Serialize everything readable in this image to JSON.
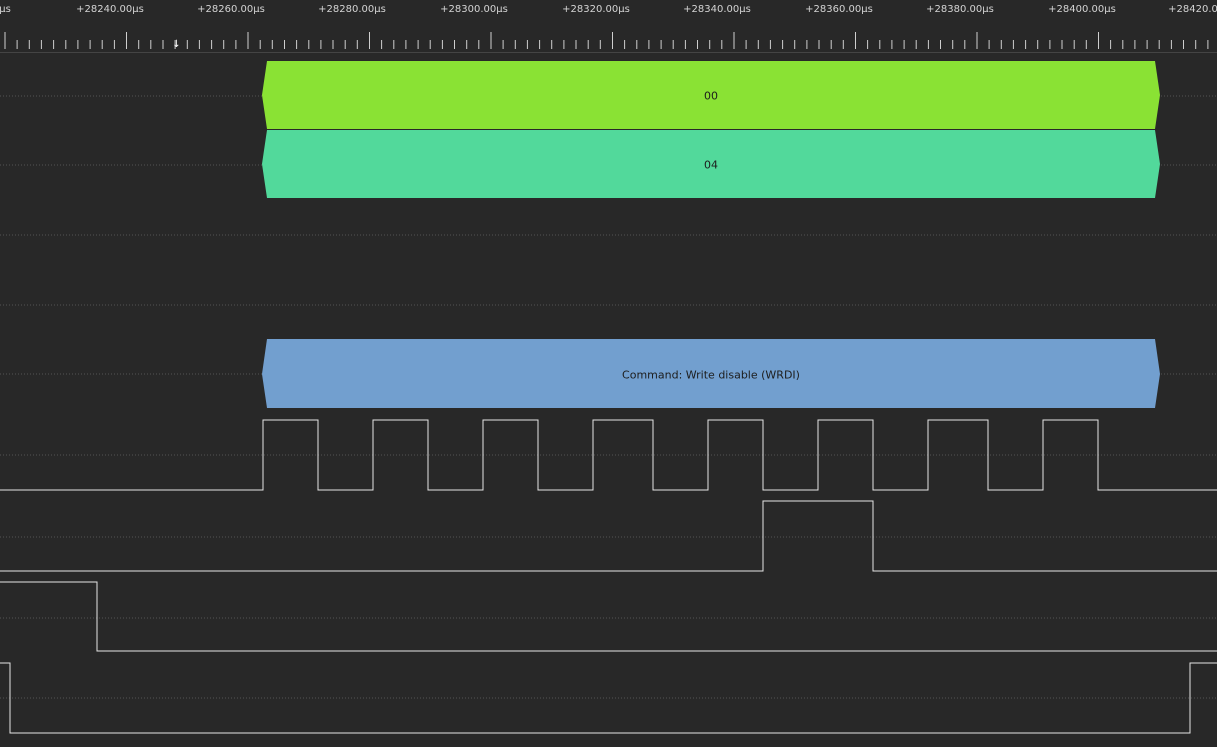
{
  "ruler": {
    "labels": [
      "μs",
      "+28240.00μs",
      "+28260.00μs",
      "+28280.00μs",
      "+28300.00μs",
      "+28320.00μs",
      "+28340.00μs",
      "+28360.00μs",
      "+28380.00μs",
      "+28400.00μs",
      "+28420.0"
    ]
  },
  "decoders": {
    "mosi_byte": "00",
    "miso_byte": "04",
    "command": "Command: Write disable (WRDI)"
  },
  "colors": {
    "background": "#282828",
    "mosi_band": "#8ae234",
    "miso_band": "#52d99b",
    "command_band": "#729fcf",
    "trace": "#e6e6e6",
    "gridline": "#555555"
  },
  "icons": {
    "cursor_marker": "down-arrow-icon"
  }
}
